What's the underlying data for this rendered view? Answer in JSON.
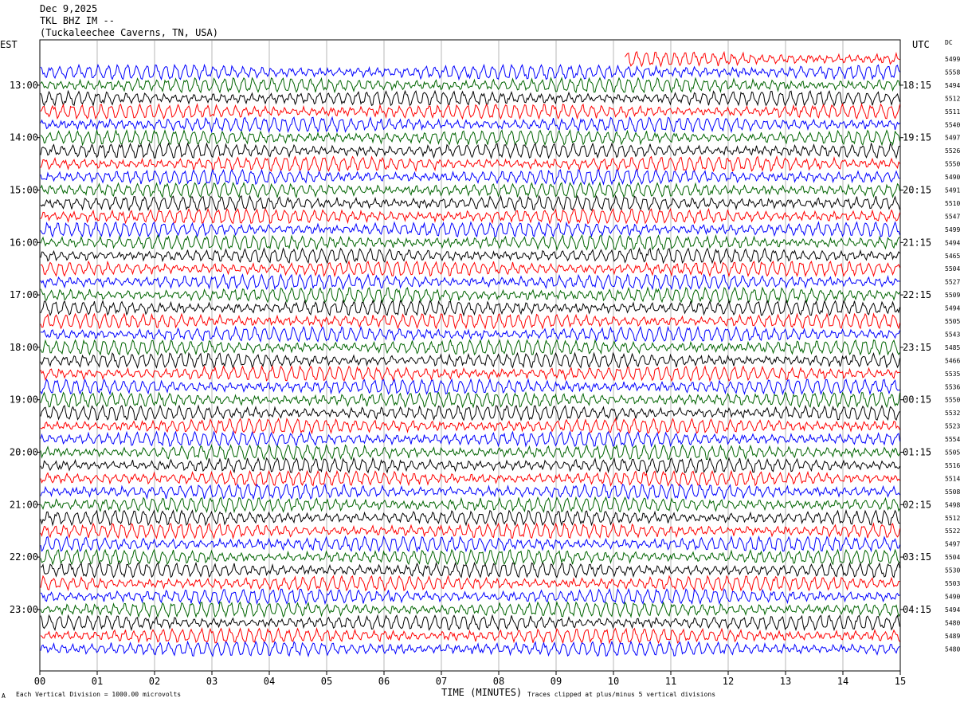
{
  "header": {
    "date": "Dec 9,2025",
    "station": "TKL BHZ IM --",
    "location": "(Tuckaleechee Caverns, TN, USA)"
  },
  "left_corner_label": "EST",
  "right_corner_label": "UTC",
  "dc_label": "DC",
  "footer": {
    "scale_mark": "A",
    "scale_note": "Each Vertical Division = 1000.00 microvolts",
    "clip_note": "Traces clipped at plus/minus 5 vertical divisions"
  },
  "colors": {
    "black": "#000000",
    "red": "#ff0000",
    "blue": "#0000ff",
    "green": "#006400"
  },
  "chart_data": {
    "type": "line",
    "title": "",
    "xlabel": "TIME (MINUTES)",
    "ylabel": "",
    "xlim": [
      0,
      15
    ],
    "x_ticks": [
      "00",
      "01",
      "02",
      "03",
      "04",
      "05",
      "06",
      "07",
      "08",
      "09",
      "10",
      "11",
      "12",
      "13",
      "14",
      "15"
    ],
    "row_interval_minutes": 15,
    "first_trace_start_minute": 10.2,
    "trace_color_cycle": [
      "red",
      "blue",
      "green",
      "black"
    ],
    "left_hour_labels": [
      "13:00",
      "14:00",
      "15:00",
      "16:00",
      "17:00",
      "18:00",
      "19:00",
      "20:00",
      "21:00",
      "22:00",
      "23:00"
    ],
    "right_hour_labels": [
      "18:15",
      "19:15",
      "20:15",
      "21:15",
      "22:15",
      "23:15",
      "00:15",
      "01:15",
      "02:15",
      "03:15",
      "04:15"
    ],
    "dc_offsets": [
      "5499",
      "5558",
      "5494",
      "5512",
      "5511",
      "5540",
      "5497",
      "5526",
      "5550",
      "5490",
      "5491",
      "5510",
      "5547",
      "5499",
      "5494",
      "5465",
      "5504",
      "5527",
      "5509",
      "5494",
      "5505",
      "5543",
      "5485",
      "5466",
      "5535",
      "5536",
      "5550",
      "5532",
      "5523",
      "5554",
      "5505",
      "5516",
      "5514",
      "5508",
      "5498",
      "5512",
      "5522",
      "5497",
      "5504",
      "5530",
      "5503",
      "5490",
      "5494",
      "5480",
      "5489",
      "5480"
    ],
    "grid": true
  }
}
